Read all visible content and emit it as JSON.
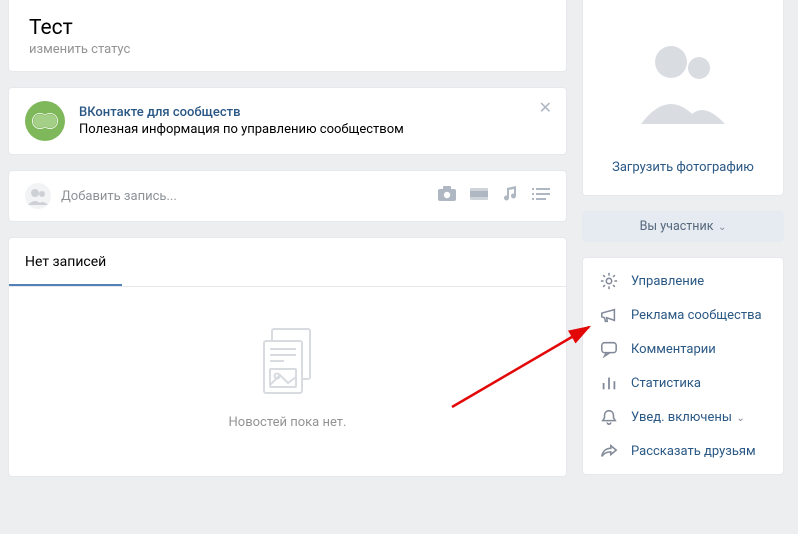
{
  "header": {
    "title": "Тест",
    "status": "изменить статус"
  },
  "suggestion": {
    "title": "ВКонтакте для сообществ",
    "text": "Полезная информация по управлению сообществом",
    "close": "✕"
  },
  "composer": {
    "placeholder": "Добавить запись..."
  },
  "wall": {
    "tab": "Нет записей",
    "empty": "Новостей пока нет."
  },
  "side": {
    "upload": "Загрузить фотографию",
    "member_btn": "Вы участник",
    "menu": {
      "manage": "Управление",
      "ads": "Реклама сообщества",
      "comments": "Комментарии",
      "stats": "Статистика",
      "notify": "Увед. включены",
      "share": "Рассказать друзьям"
    }
  }
}
